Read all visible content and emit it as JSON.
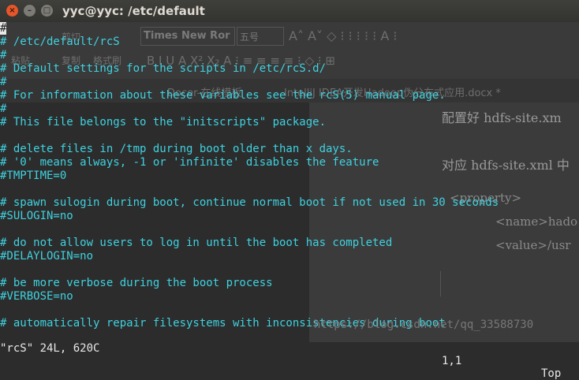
{
  "window": {
    "title": "yyc@yyc: /etc/default"
  },
  "background": {
    "ribbon": {
      "cut": "剪切",
      "paste": "粘贴",
      "copy": "复制",
      "format_painter": "格式刷",
      "font_name": "Times New Ror",
      "font_size": "五号"
    },
    "doc_tabs": [
      "Docer-在线模板",
      "IntelliJ IDEA开发Hadoop伪分布式应用.docx *"
    ],
    "doc_lines": [
      "配置好 hdfs-site.xm",
      "对应 hdfs-site.xml 中",
      "<property>",
      "<name>hado",
      "<value>/usr"
    ],
    "watermark": "https://blog.csdn.net/qq_33588730"
  },
  "editor": {
    "lines": [
      "#",
      "# /etc/default/rcS",
      "#",
      "# Default settings for the scripts in /etc/rcS.d/",
      "#",
      "# For information about these variables see the rcS(5) manual page.",
      "#",
      "# This file belongs to the \"initscripts\" package.",
      "",
      "# delete files in /tmp during boot older than x days.",
      "# '0' means always, -1 or 'infinite' disables the feature",
      "#TMPTIME=0",
      "",
      "# spawn sulogin during boot, continue normal boot if not used in 30 seconds",
      "#SULOGIN=no",
      "",
      "# do not allow users to log in until the boot has completed",
      "#DELAYLOGIN=no",
      "",
      "# be more verbose during the boot process",
      "#VERBOSE=no",
      "",
      "# automatically repair filesystems with inconsistencies during boot"
    ],
    "status": {
      "file_info": "\"rcS\" 24L, 620C",
      "position": "1,1",
      "scroll": "Top"
    }
  }
}
